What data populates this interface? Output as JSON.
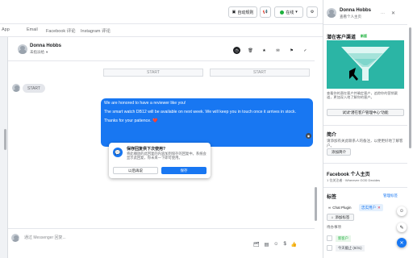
{
  "topbar": {
    "auto_rule_label": "自动规则",
    "status_label": "在线",
    "megaphone_icon": "megaphone-icon",
    "gear_icon": "gear-icon"
  },
  "tabs": [
    "App",
    "Email",
    "Facebook 评论",
    "Instagram 评论"
  ],
  "header": {
    "contact_name": "Donna Hobbs",
    "assignee": "未指派给"
  },
  "messages": {
    "start_label": "START",
    "bubble_lines": [
      "We are honored to have a reviewer like you!",
      "The smart watch DB12 will be available on next week. We will keep you in touch once it arrives in stock.",
      "Thanks for your patience."
    ],
    "heart": "❤️"
  },
  "popup": {
    "title": "保存回复供下次使用?",
    "body": "将此播放的此回复的内容加到保存的回复中。系统会显示此回复，你未来一下即可使用。",
    "cancel_label": "以后再说",
    "confirm_label": "保存"
  },
  "composer": {
    "placeholder": "通过 Messenger 回复..."
  },
  "sidebar": {
    "contact_name": "Donna Hobbs",
    "contact_sub": "查看个人主页",
    "potential_title": "潜在客户渠道",
    "potential_badge": "新版",
    "funnel_caption": "查看你的潜在客户并确定客户，追踪你的营销渠道，更加深入地了解你的客户。",
    "try_button": "试试“潜在客户管理中心”功能",
    "bio_title": "简介",
    "bio_text": "请添加有关此联系人的备注，以便更好地了解客户。",
    "bio_button": "添加简介",
    "fb_title": "Facebook 个人主页",
    "fb_sub": "1 位关注者 · Wherever GOD Decides",
    "tags_title": "标签",
    "tags_manage": "管理标签",
    "tag1": "Chat Plugin",
    "tag2": "忠实用户",
    "add_tag": "添加标签",
    "activity_title": "待办事项",
    "activity1": "新客户",
    "activity2": "今天截止 (8/31)"
  },
  "colors": {
    "accent": "#1877f2",
    "funnel_bg": "#2bb5a5",
    "tag_highlight": "#e4f0fd",
    "badge_green": "#1db13d"
  }
}
